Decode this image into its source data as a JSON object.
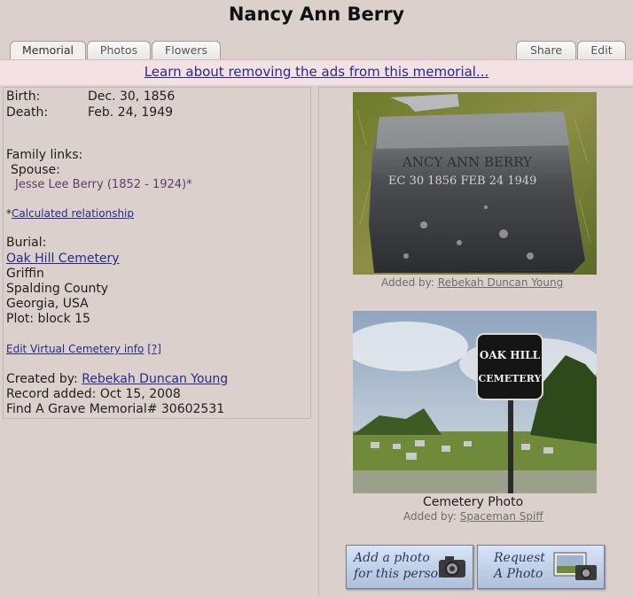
{
  "page": {
    "title": "Nancy Ann Berry"
  },
  "tabs": {
    "memorial": "Memorial",
    "photos": "Photos",
    "flowers": "Flowers",
    "share": "Share",
    "edit": "Edit"
  },
  "ad": {
    "text": "Learn about removing the ads from this memorial..."
  },
  "info": {
    "birth_label": "Birth:",
    "birth": "Dec. 30, 1856",
    "death_label": "Death:",
    "death": "Feb. 24, 1949",
    "family_label": "Family links:",
    "spouse_label": "Spouse:",
    "spouse": "Jesse Lee Berry (1852 - 1924)*",
    "calc_prefix": "*",
    "calc": "Calculated relationship",
    "burial_label": "Burial:",
    "cemetery": "Oak Hill Cemetery",
    "city": "Griffin",
    "county": "Spalding County",
    "state": "Georgia, USA",
    "plot": "Plot: block 15",
    "edit_virtual": "Edit Virtual Cemetery info",
    "help": "[?]",
    "created_label": "Created by:",
    "created_by": "Rebekah Duncan Young",
    "record_added": "Record added: Oct 15, 2008",
    "memorial_id": "Find A Grave Memorial# 30602531"
  },
  "photo1": {
    "added_prefix": "Added by:",
    "added_by": "Rebekah Duncan Young",
    "engraving_name": "ANCY ANN BERRY",
    "engraving_dates": "EC 30 1856   FEB 24 1949"
  },
  "photo2": {
    "caption": "Cemetery Photo",
    "added_prefix": "Added by:",
    "added_by": "Spaceman Spiff",
    "sign_line1": "OAK HILL",
    "sign_line2": "CEMETERY"
  },
  "buttons": {
    "add_photo_l1": "Add a photo",
    "add_photo_l2": "for this person",
    "request_l1": "Request",
    "request_l2": "A Photo"
  }
}
